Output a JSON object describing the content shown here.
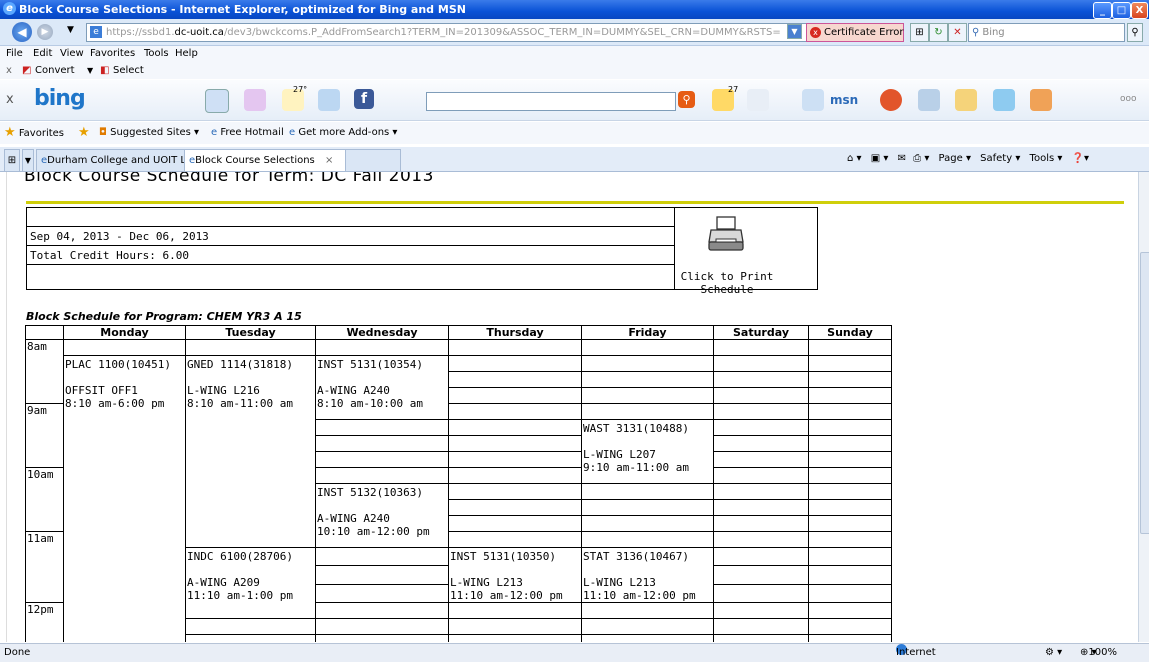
{
  "window": {
    "title": "Block Course Selections - Internet Explorer, optimized for Bing and MSN"
  },
  "address": {
    "prefix": "https://ssbd1.",
    "host": "dc-uoit.ca",
    "rest": "/dev3/bwckcoms.P_AddFromSearch1?TERM_IN=201309&ASSOC_TERM_IN=DUMMY&SEL_CRN=DUMMY&RSTS=",
    "cert_error": "Certificate Error",
    "search_placeholder": "Bing"
  },
  "menu": [
    "File",
    "Edit",
    "View",
    "Favorites",
    "Tools",
    "Help"
  ],
  "convert_bar": {
    "convert": "Convert",
    "select": "Select"
  },
  "bing_toolbar": {
    "logo": "bing",
    "weather": "27°",
    "badge": "27",
    "msn": "msn"
  },
  "favorites_bar": {
    "favorites": "Favorites",
    "items": [
      "Suggested Sites",
      "Free Hotmail",
      "Get more Add-ons"
    ]
  },
  "tabs": [
    {
      "label": "Durham College and UOIT Lo..."
    },
    {
      "label": "Block Course Selections"
    }
  ],
  "command_bar": {
    "page": "Page",
    "safety": "Safety",
    "tools": "Tools"
  },
  "page": {
    "heading": "Block Course Schedule for Term: DC Fall 2013",
    "info_rows": [
      "",
      "Sep 04, 2013 - Dec 06, 2013",
      "Total Credit Hours: 6.00",
      ""
    ],
    "print_label": "Click to Print Schedule",
    "program_title": "Block Schedule for Program: CHEM YR3 A 15"
  },
  "schedule": {
    "days": [
      "Monday",
      "Tuesday",
      "Wednesday",
      "Thursday",
      "Friday",
      "Saturday",
      "Sunday"
    ],
    "hours": [
      "8am",
      "9am",
      "10am",
      "11am",
      "12pm"
    ],
    "courses": [
      {
        "day": "Monday",
        "code": "PLAC 1100(10451)",
        "room": "OFFSIT OFF1",
        "time": "8:10 am-6:00 pm"
      },
      {
        "day": "Tuesday",
        "code": "GNED 1114(31818)",
        "room": "L-WING L216",
        "time": "8:10 am-11:00 am"
      },
      {
        "day": "Wednesday",
        "code": "INST 5131(10354)",
        "room": "A-WING A240",
        "time": "8:10 am-10:00 am"
      },
      {
        "day": "Friday",
        "code": "WAST 3131(10488)",
        "room": "L-WING L207",
        "time": "9:10 am-11:00 am"
      },
      {
        "day": "Wednesday",
        "code": "INST 5132(10363)",
        "room": "A-WING A240",
        "time": "10:10 am-12:00 pm"
      },
      {
        "day": "Tuesday",
        "code": "INDC 6100(28706)",
        "room": "A-WING A209",
        "time": "11:10 am-1:00 pm"
      },
      {
        "day": "Thursday",
        "code": "INST 5131(10350)",
        "room": "L-WING L213",
        "time": "11:10 am-12:00 pm"
      },
      {
        "day": "Friday",
        "code": "STAT 3136(10467)",
        "room": "L-WING L213",
        "time": "11:10 am-12:00 pm"
      }
    ]
  },
  "status": {
    "left": "Done",
    "zone": "Internet",
    "zoom": "100%"
  }
}
